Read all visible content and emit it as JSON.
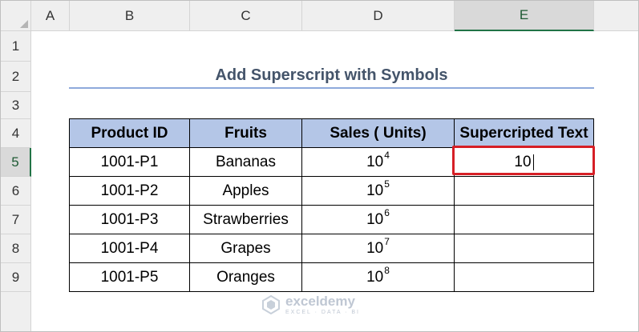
{
  "columns": [
    "A",
    "B",
    "C",
    "D",
    "E"
  ],
  "active_column": "E",
  "rows": [
    "1",
    "2",
    "3",
    "4",
    "5",
    "6",
    "7",
    "8",
    "9"
  ],
  "active_row": "5",
  "title": "Add Superscript with Symbols",
  "table": {
    "headers": [
      "Product ID",
      "Fruits",
      "Sales ( Units)",
      "Supercripted Text"
    ],
    "rows": [
      {
        "id": "1001-P1",
        "fruit": "Bananas",
        "base": "10",
        "exp": "4",
        "text": "10"
      },
      {
        "id": "1001-P2",
        "fruit": "Apples",
        "base": "10",
        "exp": "5",
        "text": ""
      },
      {
        "id": "1001-P3",
        "fruit": "Strawberries",
        "base": "10",
        "exp": "6",
        "text": ""
      },
      {
        "id": "1001-P4",
        "fruit": "Grapes",
        "base": "10",
        "exp": "7",
        "text": ""
      },
      {
        "id": "1001-P5",
        "fruit": "Oranges",
        "base": "10",
        "exp": "8",
        "text": ""
      }
    ]
  },
  "watermark": {
    "name": "exceldemy",
    "tagline": "EXCEL · DATA · BI"
  },
  "colors": {
    "header_fill": "#b4c6e7",
    "title_text": "#44546a",
    "title_rule": "#8eaadb",
    "selection": "#d61f26",
    "excel_green": "#217346"
  }
}
